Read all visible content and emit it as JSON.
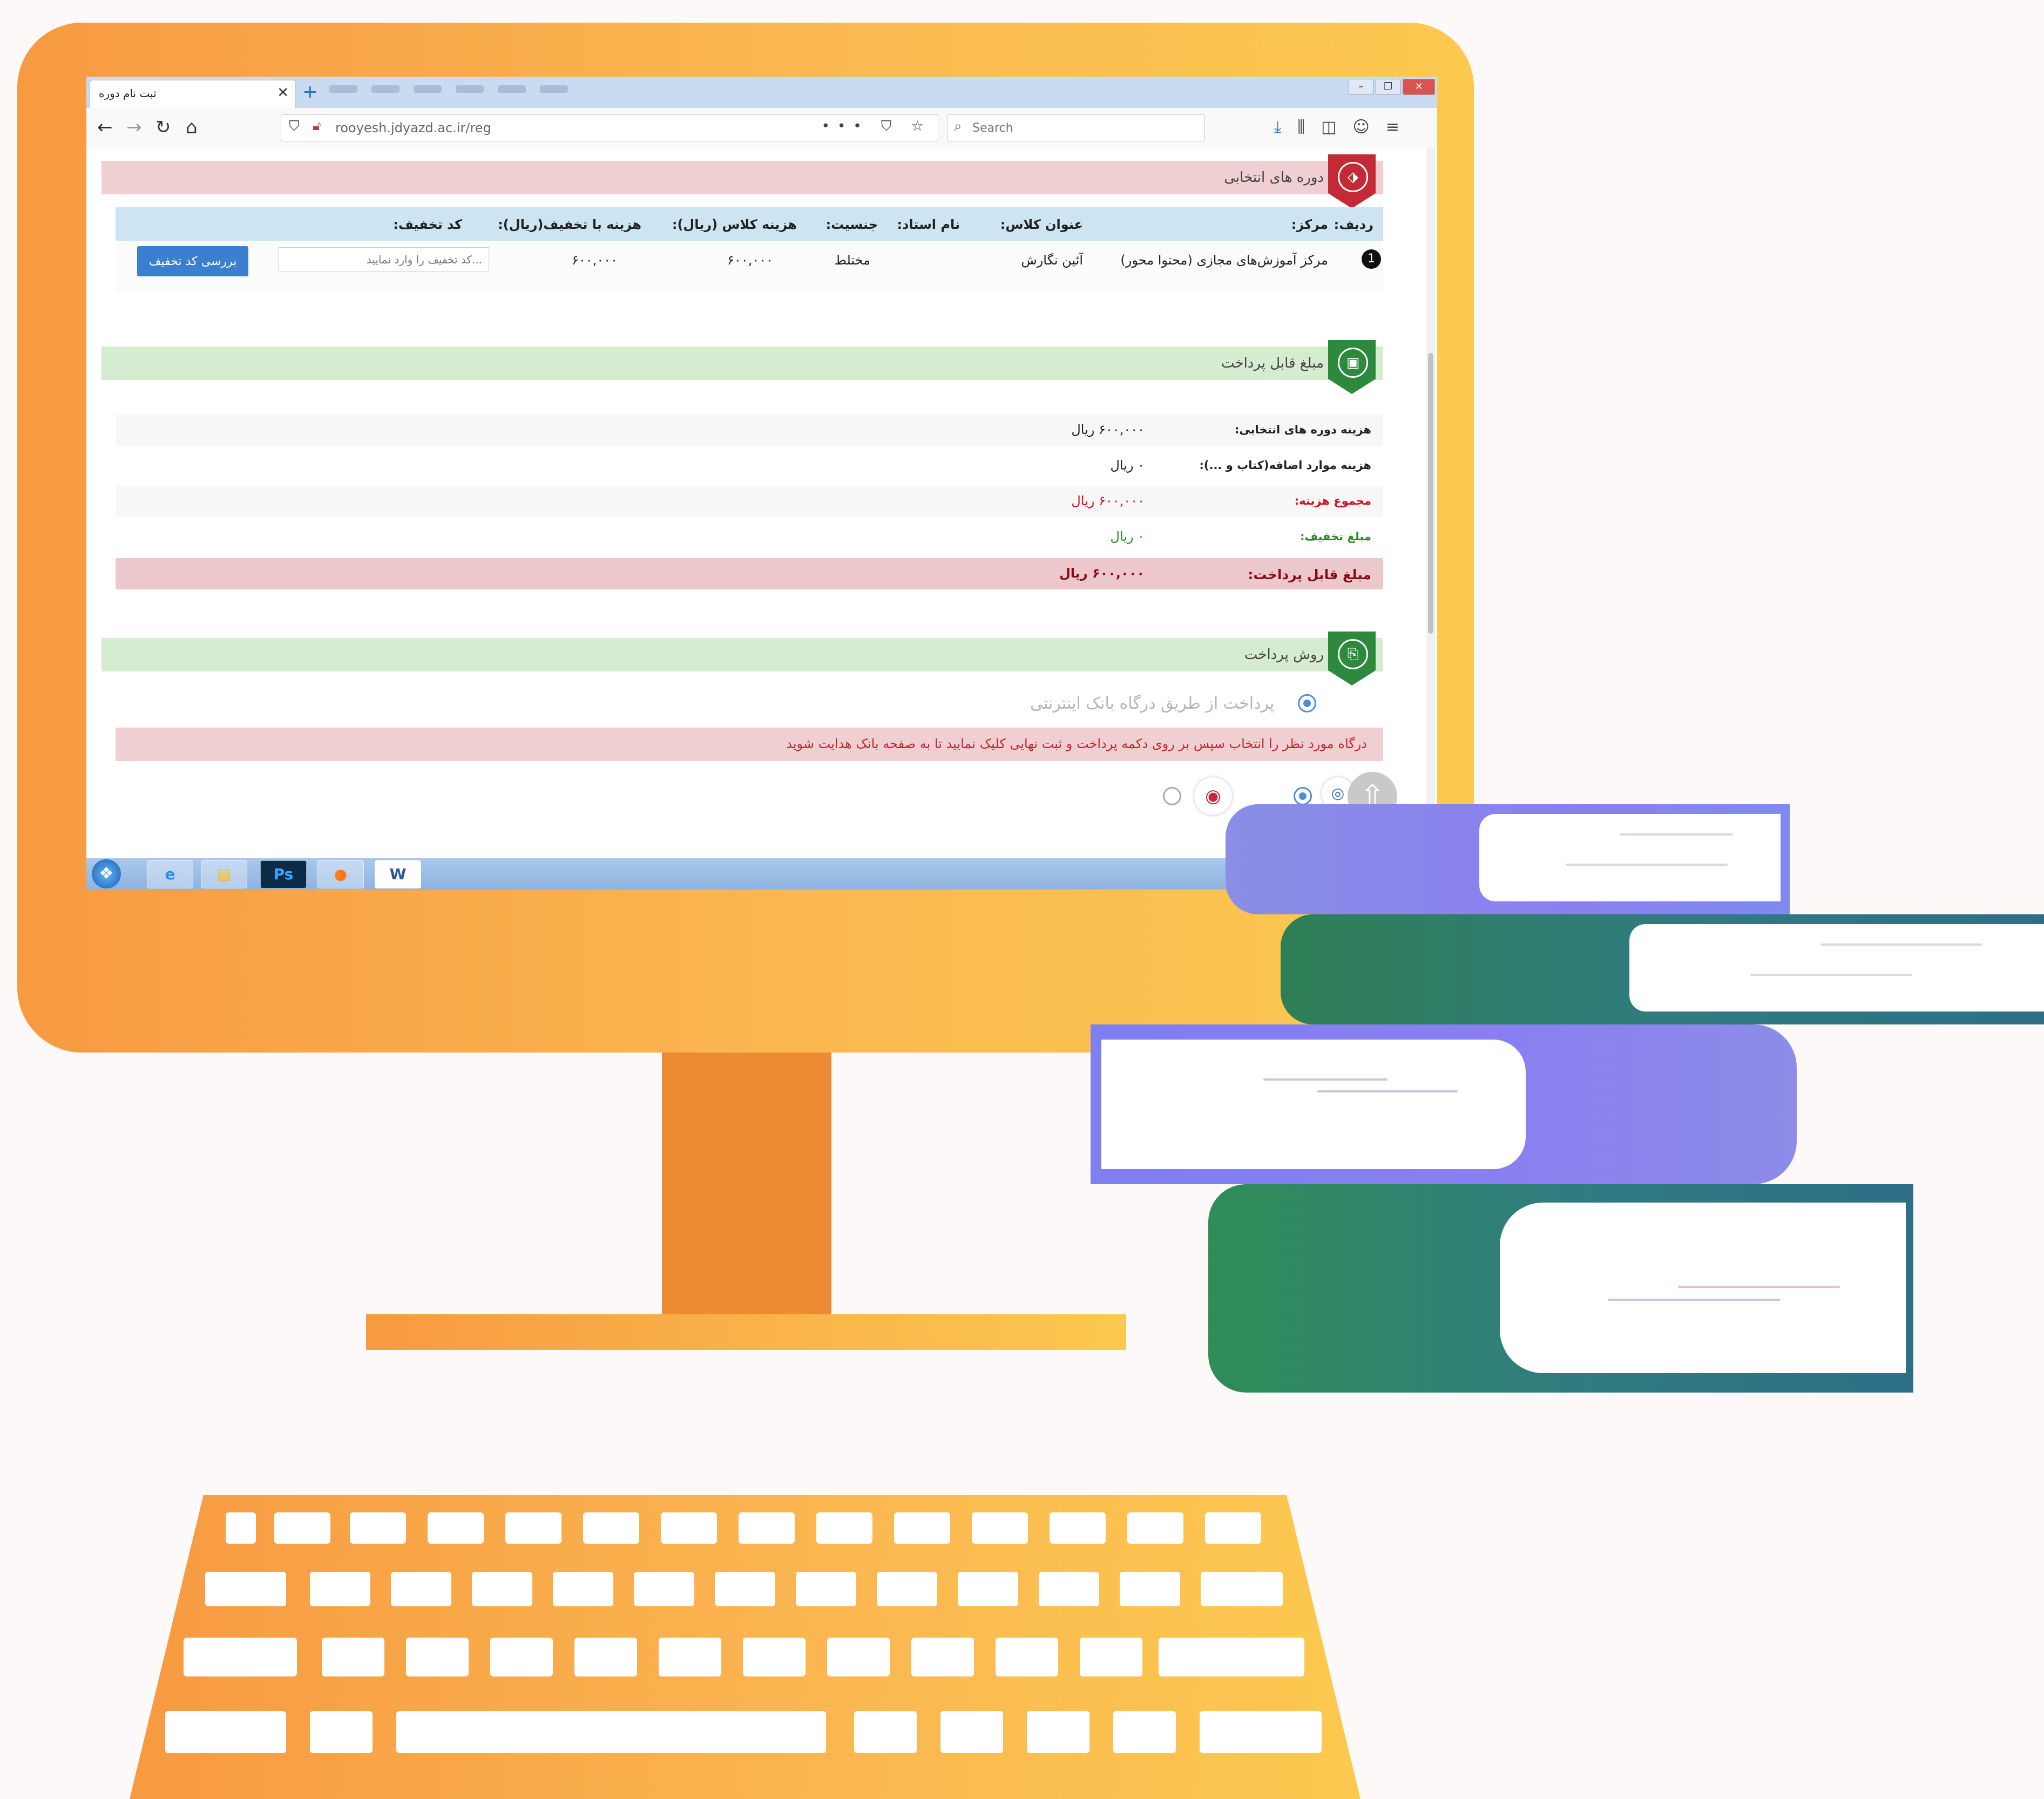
{
  "browser": {
    "tab_title": "ثبت نام دوره",
    "tab_close_icon": "close-icon",
    "new_tab_icon": "plus-icon",
    "url": "rooyesh.jdyazd.ac.ir/reg",
    "url_actions": "••• ⛉ ☆",
    "search_placeholder": "Search",
    "window_controls": {
      "minimize": "–",
      "restore": "❐",
      "close": "✕"
    },
    "nav_icons": [
      "back-arrow-icon",
      "forward-arrow-icon",
      "reload-icon",
      "home-icon"
    ]
  },
  "selected_courses": {
    "title": "دوره های انتخابی",
    "headers": {
      "row": "ردیف:",
      "center": "مرکز:",
      "class_title": "عنوان کلاس:",
      "teacher": "نام استاد:",
      "gender": "جنسیت:",
      "class_fee": "هزینه کلاس (ریال):",
      "fee_with_discount": "هزینه با تخفیف(ریال):",
      "discount_code": "کد تخفیف:"
    },
    "rows": [
      {
        "row": "1",
        "center": "مرکز آموزش‌های مجازی (محتوا محور)",
        "class_title": "آئین نگارش",
        "teacher": "",
        "gender": "مختلط",
        "class_fee": "۶۰۰,۰۰۰",
        "fee_with_discount": "۶۰۰,۰۰۰"
      }
    ],
    "discount_placeholder": "کد تخفیف را وارد نمایید...",
    "check_discount_button": "بررسی کد تخفیف"
  },
  "payable": {
    "title": "مبلغ قابل پرداخت",
    "rows": [
      {
        "label": "هزینه دوره های انتخابی:",
        "value": "۶۰۰,۰۰۰  ریال",
        "style": "normal"
      },
      {
        "label": "هزینه موارد اضافه(کتاب و ...):",
        "value": "۰  ریال",
        "style": "normal"
      },
      {
        "label": "مجموع هزینه:",
        "value": "۶۰۰,۰۰۰  ریال",
        "style": "red"
      },
      {
        "label": "مبلغ تخفیف:",
        "value": "۰  ریال",
        "style": "green"
      },
      {
        "label": "مبلغ قابل پرداخت:",
        "value": "۶۰۰,۰۰۰  ریال",
        "style": "total"
      }
    ]
  },
  "payment_method": {
    "title": "روش پرداخت",
    "option_label": "پرداخت از طریق درگاه بانک اینترنتی",
    "gateway_note": "درگاه مورد نظر را انتخاب سپس بر روی دکمه پرداخت و ثبت نهایی کلیک نمایید تا به صفحه بانک هدایت شوید"
  },
  "taskbar": {
    "items": [
      "internet-explorer-icon",
      "folder-icon",
      "photoshop-icon",
      "firefox-icon",
      "word-icon"
    ],
    "labels": {
      "photoshop": "Ps",
      "word": "W"
    }
  },
  "colors": {
    "monitor_gradient": [
      "#f79a42",
      "#fcc94f"
    ],
    "red_band": "#f0cfd3",
    "green_band": "#d6ecd0",
    "button_blue": "#3b7fd1",
    "total_red": "#d0121b",
    "discount_green": "#2b8a2b",
    "book_purple": "#8a7ff0",
    "book_teal": "#2f7b82"
  }
}
